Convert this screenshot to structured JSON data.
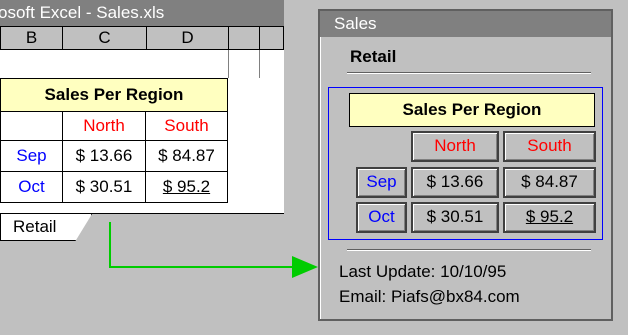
{
  "excel": {
    "title": "osoft Excel - Sales.xls",
    "columns": [
      "B",
      "C",
      "D"
    ],
    "table_title": "Sales Per Region",
    "headers": [
      "North",
      "South"
    ],
    "rows": [
      {
        "label": "Sep",
        "north": "$ 13.66",
        "south": "$ 84.87"
      },
      {
        "label": "Oct",
        "north": "$ 30.51",
        "south": "$ 95.2"
      }
    ],
    "sheet_tab": "Retail"
  },
  "preview": {
    "title": "Sales",
    "heading": "Retail",
    "table_title": "Sales Per Region",
    "headers": [
      "North",
      "South"
    ],
    "rows": [
      {
        "label": "Sep",
        "north": "$ 13.66",
        "south": "$ 84.87"
      },
      {
        "label": "Oct",
        "north": "$ 30.51",
        "south": "$ 95.2"
      }
    ],
    "last_update": "Last Update: 10/10/95",
    "email": "Email: Piafs@bx84.com"
  },
  "colors": {
    "background": "#c0c0c0",
    "titlebar": "#808080",
    "header_text": "#ff0000",
    "row_label_text": "#0000ff",
    "banner_fill": "#ffffc0",
    "arrow": "#00cc00"
  }
}
